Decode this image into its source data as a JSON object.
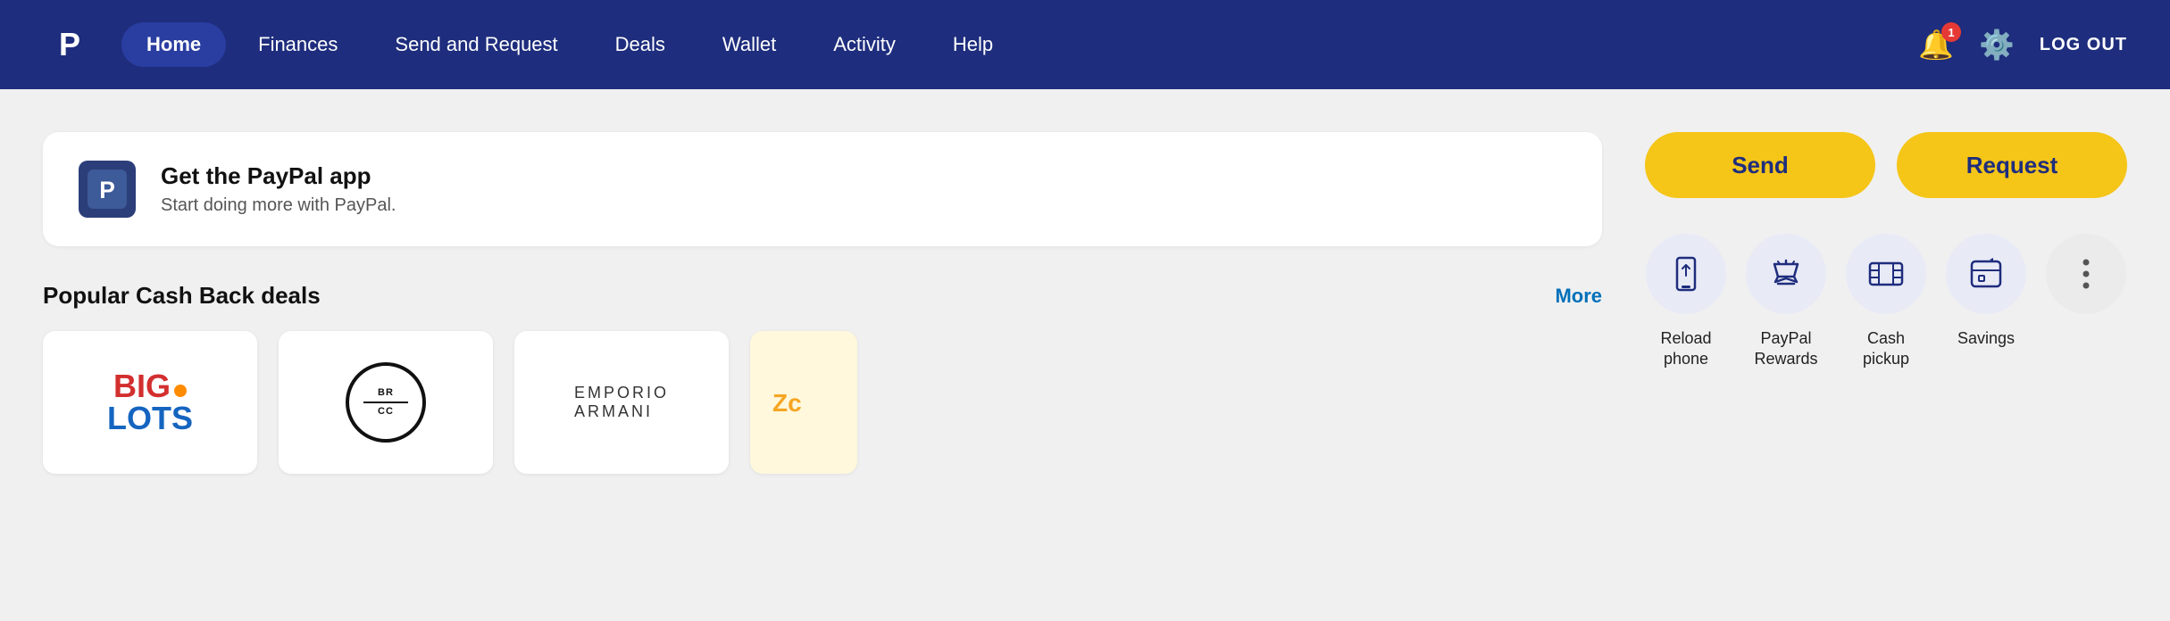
{
  "navbar": {
    "logo_text": "P",
    "items": [
      {
        "id": "home",
        "label": "Home",
        "active": true
      },
      {
        "id": "finances",
        "label": "Finances",
        "active": false
      },
      {
        "id": "send-request",
        "label": "Send and Request",
        "active": false
      },
      {
        "id": "deals",
        "label": "Deals",
        "active": false
      },
      {
        "id": "wallet",
        "label": "Wallet",
        "active": false
      },
      {
        "id": "activity",
        "label": "Activity",
        "active": false
      },
      {
        "id": "help",
        "label": "Help",
        "active": false
      }
    ],
    "notification_count": "1",
    "logout_label": "LOG OUT"
  },
  "app_banner": {
    "title": "Get the PayPal app",
    "subtitle": "Start doing more with PayPal.",
    "icon_text": "P"
  },
  "deals": {
    "title": "Popular Cash Back deals",
    "more_label": "More",
    "cards": [
      {
        "id": "big-lots",
        "brand": "BIG LOTS"
      },
      {
        "id": "brcc",
        "brand": "BRCC"
      },
      {
        "id": "armani",
        "brand": "EMPORIO ARMANI"
      },
      {
        "id": "partial",
        "brand": ""
      }
    ]
  },
  "actions": {
    "send_label": "Send",
    "request_label": "Request"
  },
  "quick_actions": [
    {
      "id": "reload-phone",
      "label": "Reload\nphone",
      "icon": "📱"
    },
    {
      "id": "paypal-rewards",
      "label": "PayPal\nRewards",
      "icon": "🏆"
    },
    {
      "id": "cash-pickup",
      "label": "Cash\npickup",
      "icon": "🏧"
    },
    {
      "id": "savings",
      "label": "Savings",
      "icon": "💳"
    },
    {
      "id": "more",
      "label": "⋮",
      "icon": "⋯"
    }
  ]
}
